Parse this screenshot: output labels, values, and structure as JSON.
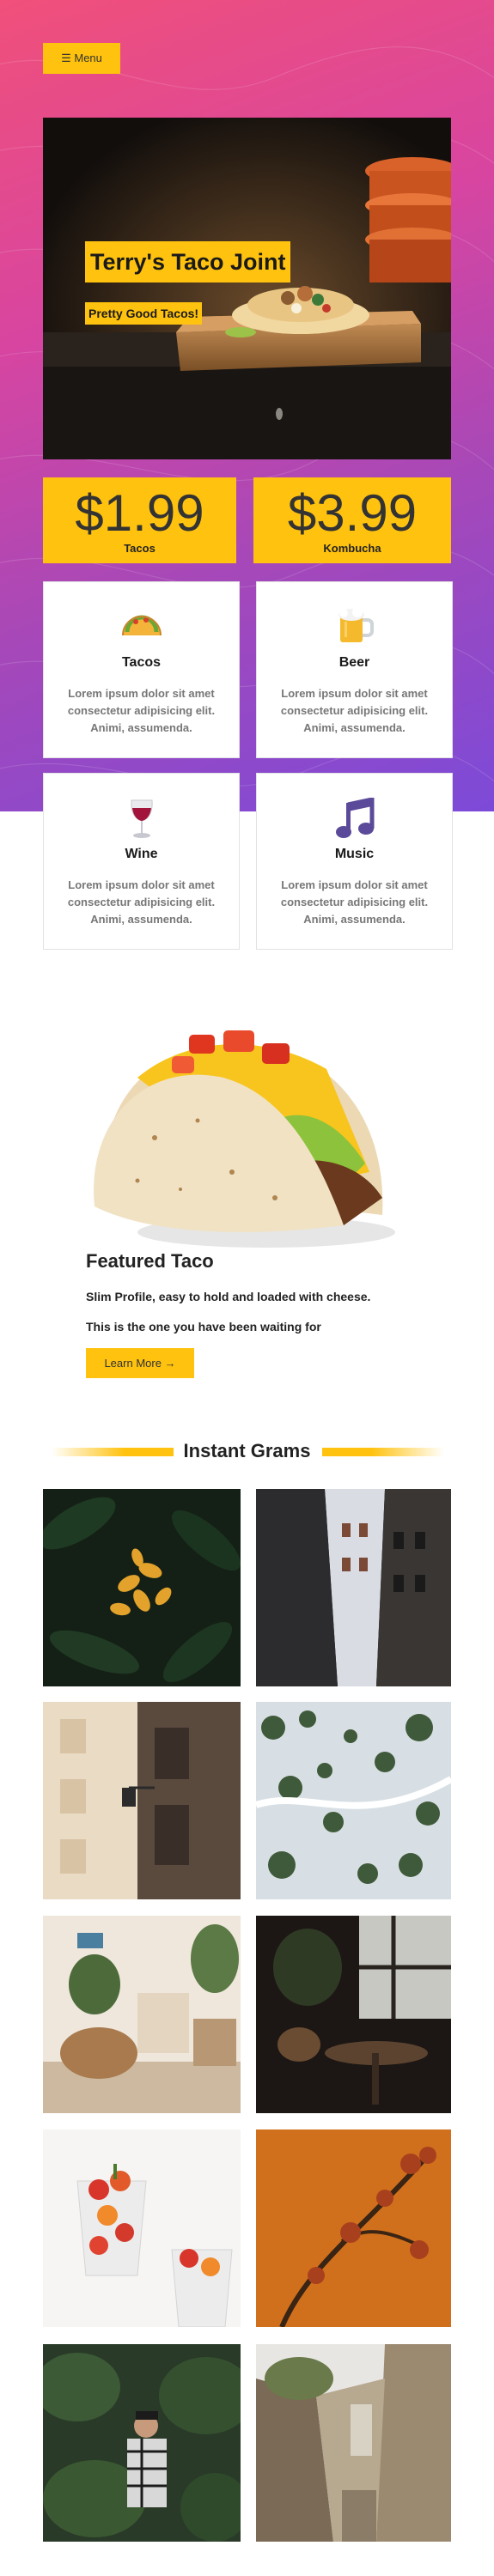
{
  "header": {
    "menu_icon": "hamburger-icon",
    "menu_label": "☰ Menu"
  },
  "hero": {
    "title": "Terry's Taco Joint",
    "subtitle": "Pretty Good Tacos!",
    "image": "taco-on-cutting-board-photo"
  },
  "prices": [
    {
      "value": "$1.99",
      "label": "Tacos"
    },
    {
      "value": "$3.99",
      "label": "Kombucha"
    }
  ],
  "cards": [
    {
      "icon": "taco-icon",
      "title": "Tacos",
      "text": "Lorem ipsum dolor sit amet consectetur adipisicing elit. Animi, assumenda."
    },
    {
      "icon": "beer-icon",
      "title": "Beer",
      "text": "Lorem ipsum dolor sit amet consectetur adipisicing elit. Animi, assumenda."
    },
    {
      "icon": "wine-glass-icon",
      "title": "Wine",
      "text": "Lorem ipsum dolor sit amet consectetur adipisicing elit. Animi, assumenda."
    },
    {
      "icon": "music-note-icon",
      "title": "Music",
      "text": "Lorem ipsum dolor sit amet consectetur adipisicing elit. Animi, assumenda."
    }
  ],
  "featured": {
    "image": "featured-taco-photo",
    "title": "Featured Taco",
    "line1": "Slim Profile, easy to hold and loaded with cheese.",
    "line2": "This is the one you have been waiting for",
    "button_label": "Learn More →"
  },
  "grams": {
    "title": "Instant Grams",
    "photos": [
      "orange-flowers-photo",
      "narrow-street-photo",
      "building-lamp-photo",
      "snowy-forest-aerial-photo",
      "living-room-photo",
      "cafe-window-photo",
      "fruit-glasses-photo",
      "orange-blossoms-photo",
      "man-in-greenery-photo",
      "stone-alley-photo"
    ]
  },
  "colors": {
    "accent": "#ffc20e",
    "gradient_start": "#f0507a",
    "gradient_end": "#7c4ad8"
  }
}
